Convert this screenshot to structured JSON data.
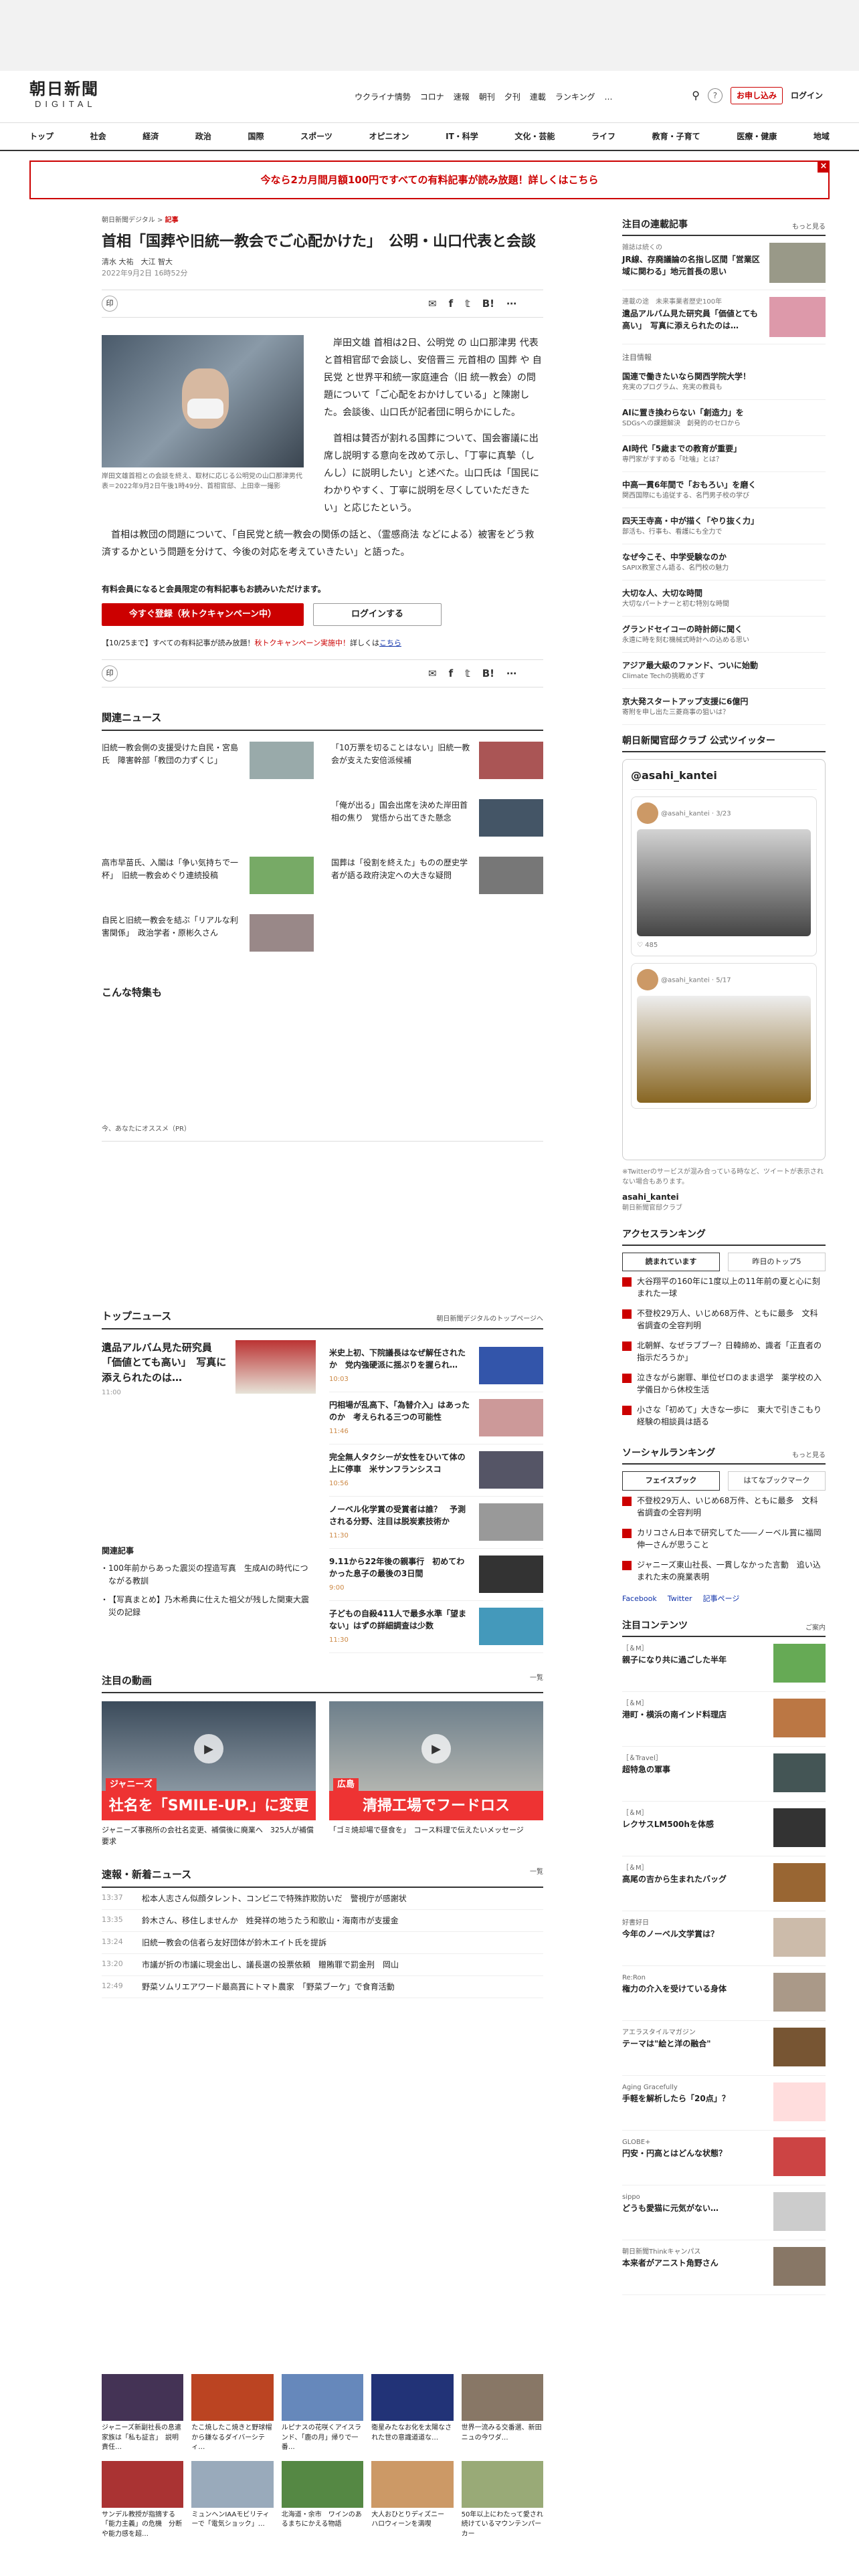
{
  "header": {
    "logo_main": "朝日新聞",
    "logo_sub": "DIGITAL",
    "topnav": [
      "ウクライナ情勢",
      "コロナ",
      "速報",
      "朝刊",
      "夕刊",
      "連載",
      "ランキング",
      "…"
    ],
    "apply": "お申し込み",
    "login": "ログイン"
  },
  "catnav": [
    "トップ",
    "社会",
    "経済",
    "政治",
    "国際",
    "スポーツ",
    "オピニオン",
    "IT・科学",
    "文化・芸能",
    "ライフ",
    "教育・子育て",
    "医療・健康",
    "地域"
  ],
  "banner": "今なら2カ月間月額100円ですべての有料記事が読み放題！詳しくはこちら",
  "article": {
    "crumb_site": "朝日新聞デジタル",
    "crumb_sep": ">",
    "crumb_cat": "記事",
    "title": "首相「国葬や旧統一教会でご心配かけた」　公明・山口代表と会談",
    "authors": "清水 大祐　大江 智大",
    "date": "2022年9月2日 16時52分",
    "caption": "岸田文雄首相との会談を終え、取材に応じる公明党の山口那津男代表＝2022年9月2日午後1時49分、首相官邸、上田幸一撮影",
    "p1": "岸田文雄 首相は2日、公明党 の 山口那津男 代表と首相官邸で会談し、安倍晋三 元首相の 国葬 や 自民党 と世界平和統一家庭連合（旧 統一教会）の問題について「ご心配をおかけしている」と陳謝した。会談後、山口氏が記者団に明らかにした。",
    "p2": "首相は賛否が割れる国葬について、国会審議に出席し説明する意向を改めて示し、「丁寧に真摯（しんし）に説明したい」と述べた。山口氏は「国民にわかりやすく、丁寧に説明を尽くしていただきたい」と応じたという。",
    "p3": "首相は教団の問題について、「自民党と統一教会の関係の話と、（霊感商法 などによる）被害をどう救済するかという問題を分けて、今後の対応を考えていきたい」と語った。",
    "notice": "有料会員になると会員限定の有料記事もお読みいただけます。",
    "register": "今すぐ登録（秋トクキャンペーン中）",
    "signin": "ログインする",
    "promo_a": "【10/25まで】すべての有料記事が読み放題！",
    "promo_b": "秋トクキャンペーン実施中！",
    "promo_c": "詳しくは",
    "promo_d": "こちら",
    "share_print": "印",
    "share_list": "list",
    "share_count": "1"
  },
  "related": {
    "heading": "関連ニュース",
    "items": [
      {
        "title": "旧統一教会側の支援受けた自民・宮島氏　障害幹部「教団の力ずくじ」"
      },
      {
        "title": "「10万票を切ることはない」旧統一教会が支えた安倍派候補"
      },
      {
        "title": ""
      },
      {
        "title": "「俺が出る」国会出席を決めた岸田首相の焦り　覚悟から出てきた懸念"
      },
      {
        "title": "高市早苗氏、入閣は「争い気持ちで一杯」　旧統一教会めぐり連続投稿"
      },
      {
        "title": "国葬は「役割を終えた」ものの歴史学者が語る政府決定への大きな疑問"
      },
      {
        "title": "自民と旧統一教会を結ぶ「リアルな利害関係」　政治学者・原彬久さん"
      }
    ]
  },
  "feature_heading": "こんな特集も",
  "pr_label": "今、あなたにオススメ（PR）",
  "topnews": {
    "heading": "トップニュース",
    "more": "朝日新聞デジタルのトップページへ",
    "lead_title": "遺品アルバム見た研究員「価値とても高い」　写真に添えられたのは…",
    "lead_time": "11:00",
    "kanren_head": "関連記事",
    "kanren": [
      "100年前からあった震災の捏造写真　生成AIの時代につながる教訓",
      "【写真まとめ】乃木希典に仕えた祖父が残した関東大震災の記録"
    ],
    "items": [
      {
        "title": "米史上初、下院議長はなぜ解任されたか　党内強硬派に揺ぶりを握られ…",
        "time": "10:03"
      },
      {
        "title": "円相場が乱高下、「為替介入」はあったのか　考えられる三つの可能性",
        "time": "11:46"
      },
      {
        "title": "完全無人タクシーが女性をひいて体の上に停車　米サンフランシスコ",
        "time": "10:56"
      },
      {
        "title": "ノーベル化学賞の受賞者は誰？　予測される分野、注目は脱炭素技術か",
        "time": "11:30"
      },
      {
        "title": "9.11から22年後の親事行　初めてわかった息子の最後の3日間",
        "time": "9:00"
      },
      {
        "title": "子どもの自殺411人で最多水準「望まない」はずの詳細調査は少数",
        "time": "11:30"
      }
    ]
  },
  "videos": {
    "heading": "注目の動画",
    "more": "一覧",
    "items": [
      {
        "cap": "社名を「SMILE-UP.」に変更",
        "tag": "ジャニーズ",
        "title": "ジャニーズ事務所の会社名変更、補償後に廃業へ　325人が補償要求"
      },
      {
        "cap": "清掃工場でフードロス",
        "tag": "広島",
        "title": "「ゴミ焼却場で昼食を」　コース料理で伝えたいメッセージ"
      }
    ]
  },
  "flash": {
    "heading": "速報・新着ニュース",
    "more": "一覧",
    "items": [
      {
        "time": "13:37",
        "title": "松本人志さん似顔タレント、コンビニで特殊詐欺防いだ　警視庁が感謝状"
      },
      {
        "time": "13:35",
        "title": "鈴木さん、移住しませんか　姓発祥の地うたう和歌山・海南市が支援金"
      },
      {
        "time": "13:24",
        "title": "旧統一教会の信者ら友好団体が鈴木エイト氏を提訴"
      },
      {
        "time": "13:20",
        "title": "市議が折の市議に現金出し、議長選の投票依頼　贈賄罪で罰金刑　岡山"
      },
      {
        "time": "12:49",
        "title": "野菜ソムリエアワード最高賞にトマト農家　「野菜ブーケ」で食育活動"
      }
    ]
  },
  "bottom": [
    {
      "title": "ジャニーズ新副社長の息遣家族は「私も証言」　説明責任…"
    },
    {
      "title": "たこ焼したこ焼きと野球帽から鎌なるダイバーシティ…"
    },
    {
      "title": "ルピナスの花咲くアイスランド、「鹿の月」帰りで一番…"
    },
    {
      "title": "衛星みたなお化を太陽なされた世の意識道道な…"
    },
    {
      "title": "世界一流みる交番選、新田ニュの今ワダ…"
    },
    {
      "title": "サンデル教授が指摘する「能力主義」の危機　分断や能力感を超…"
    },
    {
      "title": "ミュンヘンIAAモビリティーで「電気ショック」…"
    },
    {
      "title": "北海道・余市　ワインのあるまちにかえる物語"
    },
    {
      "title": "大人おひとりディズニー　ハロウィーンを満喫"
    },
    {
      "title": "50年以上にわたって愛され続けているマウンテンパーカー"
    }
  ],
  "side": {
    "reg_heading": "注目の連載記事",
    "reg_more": "もっと見る",
    "reg": [
      {
        "sub": "雑誌は続くの",
        "title": "JR線、存廃議論の名指し区間「営業区域に関わる」地元首長の思い"
      },
      {
        "sub": "連載の途　未来事業者歴史100年",
        "title": "遺品アルバム見た研究員「価値とても高い」　写真に添えられたのは…"
      }
    ],
    "notice": "注目情報",
    "promos": [
      {
        "title": "国連で働きたいなら関西学院大学！",
        "sub": "充実のプログラム、充実の教員も"
      },
      {
        "title": "AIに置き換わらない「創造力」を",
        "sub": "SDGsへの課題解決　創発的のセロから"
      },
      {
        "title": "AI時代「5歳までの教育が重要」",
        "sub": "専門家がすすめる「吐噛」とは？"
      },
      {
        "title": "中高一貫6年間で「おもろい」を磨く",
        "sub": "関西国際にも追従する、名門男子校の学び"
      },
      {
        "title": "四天王寺高・中が描く「やり抜く力」",
        "sub": "部活も、行事も、看護にも全力で"
      },
      {
        "title": "なぜ今こそ、中学受験なのか",
        "sub": "SAPIX教室さん語る、名門校の魅力"
      },
      {
        "title": "大切な人、大切な時間",
        "sub": "大切なパートナーと初む特別な時間"
      },
      {
        "title": "グランドセイコーの時計師に聞く",
        "sub": "永遠に時を刻む機械式時計への込める思い"
      },
      {
        "title": "アジア最大級のファンド、ついに始動",
        "sub": "Climate Techの挑戦めざす"
      },
      {
        "title": "京大発スタートアップ支援に6億円",
        "sub": "寄附を申し出た三菱商事の狙いは？"
      }
    ],
    "tw_heading": "朝日新聞官邸クラブ 公式ツイッター",
    "tw_title": "@asahi_kantei",
    "tw_user": "@asahi_kantei · 3/23",
    "tw_user2": "@asahi_kantei · 5/17",
    "tw_likes": "485",
    "tw_note": "※Twitterのサービスが混み合っている時など、ツイートが表示されない場合もあります。",
    "tw_name": "asahi_kantei",
    "tw_desc": "朝日新聞官邸クラブ",
    "rank_heading": "アクセスランキング",
    "rank_tabs": [
      "読まれています",
      "昨日のトップ5"
    ],
    "rank": [
      "大谷翔平の160年に1度以上の11年前の夏と心に刻まれた一球",
      "不登校29万人、いじめ68万件、ともに最多　文科省調査の全容判明",
      "北朝鮮、なぜラブブー？日韓締め、識者「正直者の指示だろうか」",
      "泣きながら謝罪、単位ゼロのまま退学　薬学校の入学儀日から休校生活",
      "小さな「初めて」大きな一歩に　東大で引きこもり経験の相談員は語る"
    ],
    "social_heading": "ソーシャルランキング",
    "social_more": "もっと見る",
    "social_tabs": [
      "フェイスブック",
      "はてなブックマーク"
    ],
    "social": [
      "不登校29万人、いじめ68万件、ともに最多　文科省調査の全容判明",
      "カリコさん日本で研究してた――ノーベル賞に福岡伸一さんが思うこと",
      "ジャニーズ東山社長、一貫しなかった言動　追い込まれた末の廃業表明"
    ],
    "social_links": [
      "Facebook",
      "Twitter",
      "記事ページ"
    ],
    "cont_heading": "注目コンテンツ",
    "cont_more": "ご案内",
    "cont": [
      {
        "lab": "［＆M］",
        "title": "親子になり共に過ごした半年"
      },
      {
        "lab": "［＆M］",
        "title": "港町・横浜の南インド料理店"
      },
      {
        "lab": "［＆Travel］",
        "title": "超特急の軍事"
      },
      {
        "lab": "［＆M］",
        "title": "レクサスLM500hを体感"
      },
      {
        "lab": "［＆M］",
        "title": "高尾の吉から生まれたバッグ"
      },
      {
        "lab": "好書好日",
        "title": "今年のノーベル文学賞は？"
      },
      {
        "lab": "Re:Ron",
        "title": "権力の介入を受けている身体"
      },
      {
        "lab": "アエラスタイルマガジン",
        "title": "テーマは\"絵と洋の融合\""
      },
      {
        "lab": "Aging Gracefully",
        "title": "手軽を解析したら「20点」？"
      },
      {
        "lab": "GLOBE+",
        "title": "円安・円高とはどんな状態？"
      },
      {
        "lab": "sippo",
        "title": "どうも愛猫に元気がない…"
      },
      {
        "lab": "朝日新聞Thinkキャンパス",
        "title": "本来者がアニスト角野さん"
      }
    ]
  }
}
